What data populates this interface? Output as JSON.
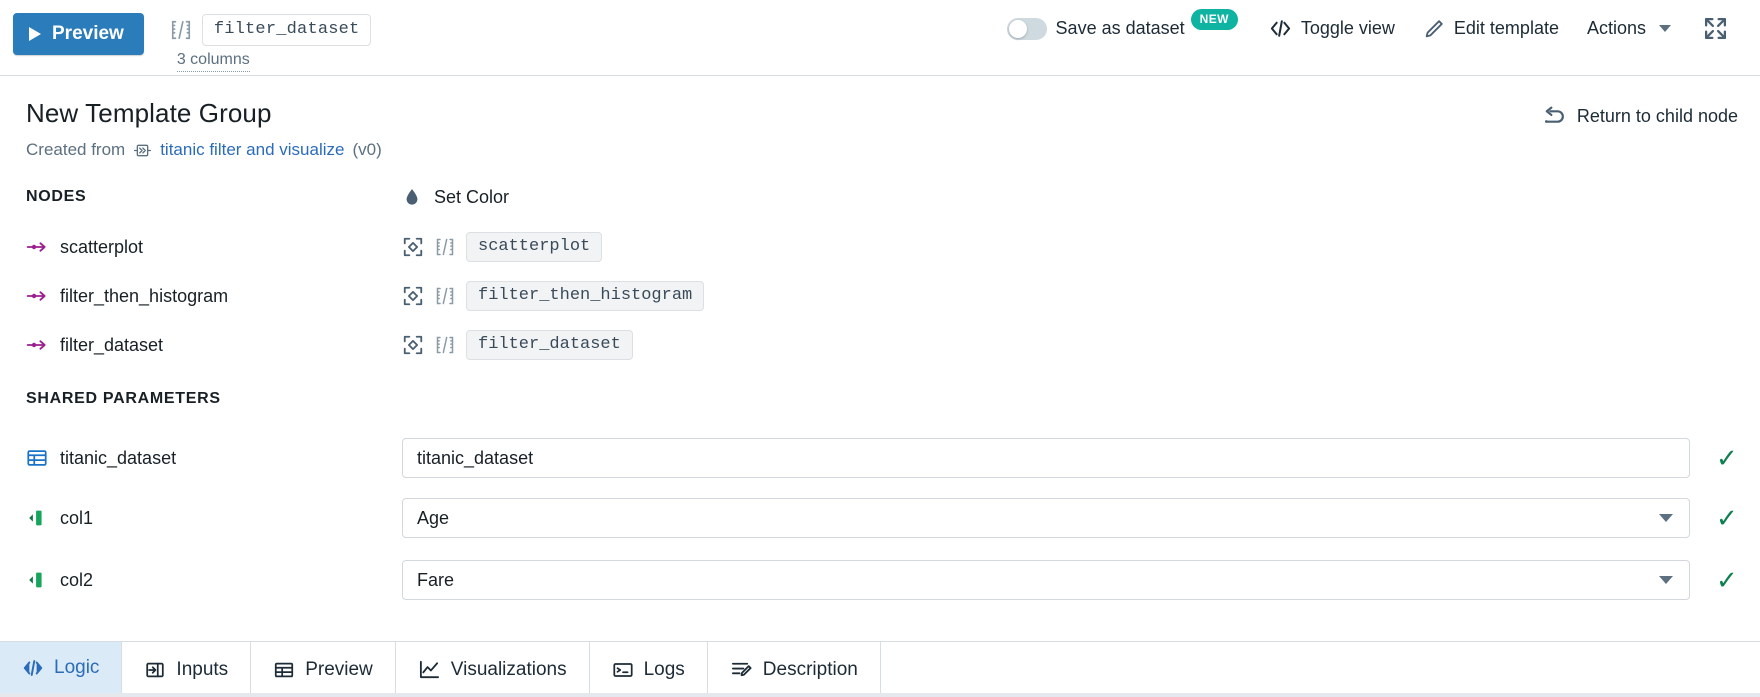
{
  "toolbar": {
    "preview_label": "Preview",
    "dataset_chip": "filter_dataset",
    "columns_link": "3 columns",
    "save_as_dataset": "Save as dataset",
    "new_badge": "NEW",
    "toggle_view": "Toggle view",
    "edit_template": "Edit template",
    "actions": "Actions",
    "toggle_state": "off",
    "accent_blue": "#2b7cbb",
    "badge_color": "#0fb3a1"
  },
  "header": {
    "title": "New Template Group",
    "created_from_label": "Created from",
    "source_template": "titanic filter and visualize",
    "source_version": "(v0)",
    "return_to_child": "Return to child node"
  },
  "nodes": {
    "section_label": "NODES",
    "set_color_label": "Set Color",
    "items": [
      {
        "name": "scatterplot",
        "value": "scatterplot"
      },
      {
        "name": "filter_then_histogram",
        "value": "filter_then_histogram"
      },
      {
        "name": "filter_dataset",
        "value": "filter_dataset"
      }
    ]
  },
  "shared_parameters": {
    "section_label": "SHARED PARAMETERS",
    "items": [
      {
        "name": "titanic_dataset",
        "icon": "table-icon",
        "type": "text",
        "value": "titanic_dataset",
        "valid": "✓"
      },
      {
        "name": "col1",
        "icon": "column-icon",
        "type": "select",
        "value": "Age",
        "valid": "✓"
      },
      {
        "name": "col2",
        "icon": "column-icon",
        "type": "select",
        "value": "Fare",
        "valid": "✓"
      }
    ]
  },
  "tabs": {
    "items": [
      {
        "label": "Logic",
        "icon": "code-icon",
        "active": true
      },
      {
        "label": "Inputs",
        "icon": "inputs-icon",
        "active": false
      },
      {
        "label": "Preview",
        "icon": "table-icon",
        "active": false
      },
      {
        "label": "Visualizations",
        "icon": "chart-line-icon",
        "active": false
      },
      {
        "label": "Logs",
        "icon": "terminal-icon",
        "active": false
      },
      {
        "label": "Description",
        "icon": "description-icon",
        "active": false
      }
    ]
  }
}
